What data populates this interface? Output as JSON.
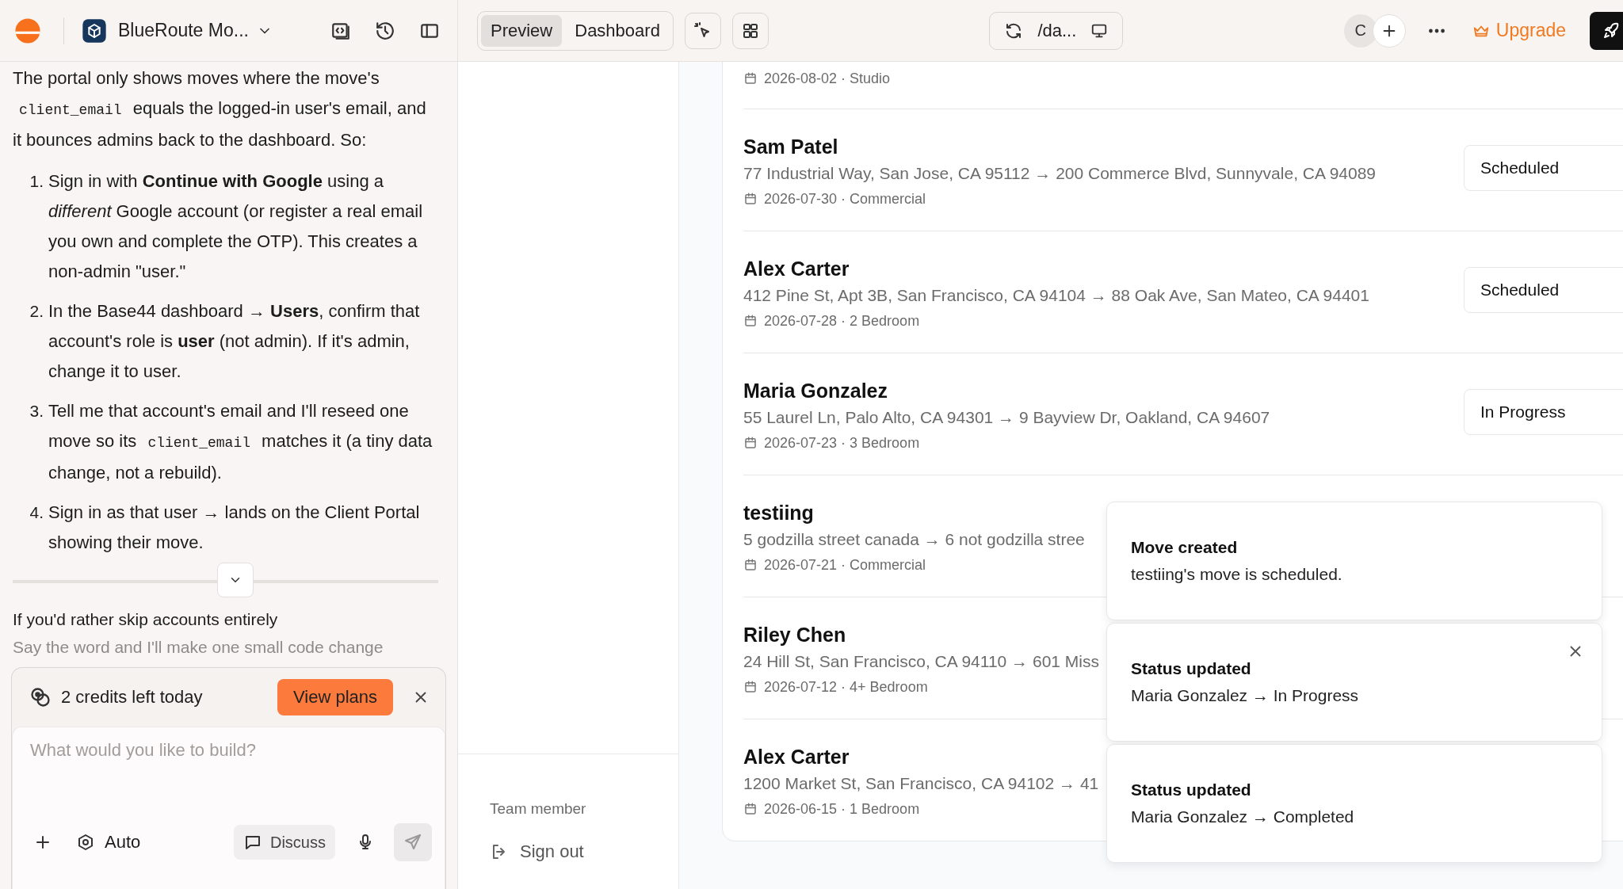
{
  "topbar": {
    "project_name": "BlueRoute Mo...",
    "view_tabs": [
      {
        "label": "Preview",
        "selected": true
      },
      {
        "label": "Dashboard",
        "selected": false
      }
    ],
    "url": "/da...",
    "avatar_initial": "C",
    "upgrade_label": "Upgrade"
  },
  "chat": {
    "paragraph": [
      {
        "kind": "text",
        "text": "The portal only shows moves where the move's "
      },
      {
        "kind": "code",
        "text": "client_email"
      },
      {
        "kind": "text",
        "text": " equals the logged-in user's email, and it bounces admins back to the dashboard. So:"
      }
    ],
    "steps": [
      {
        "number": "1.",
        "parts": [
          {
            "kind": "text",
            "text": "Sign in with **Continue with Google** using a *different* Google account (or register a real email you own and complete the OTP). This creates a non-admin \"user.\""
          }
        ]
      },
      {
        "number": "2.",
        "parts": [
          {
            "kind": "text",
            "text": "In the Base44 dashboard → **Users**, confirm that account's role is **user** (not admin). If it's admin, change it to user."
          }
        ]
      },
      {
        "number": "3.",
        "parts": [
          {
            "kind": "text",
            "text": "Tell me that account's email and I'll reseed one move so its "
          },
          {
            "kind": "code",
            "text": "client_email"
          },
          {
            "kind": "text",
            "text": " matches it (a tiny data change, not a rebuild)."
          }
        ]
      },
      {
        "number": "4.",
        "parts": [
          {
            "kind": "text",
            "text": "Sign in as that user → lands on the Client Portal showing their move."
          }
        ]
      }
    ],
    "followup": "If you'd rather skip accounts entirely",
    "faded_line": "Say the word and I'll make one small code change"
  },
  "composer": {
    "credits": "2 credits left today",
    "plans_button": "View plans",
    "placeholder": "What would you like to build?",
    "mode": "Auto",
    "discuss": "Discuss"
  },
  "sidebar": {
    "role": "Team member",
    "sign_out": "Sign out"
  },
  "moves": [
    {
      "meta": "2026-08-02 · Studio"
    },
    {
      "name": "Sam Patel",
      "address": "77 Industrial Way, San Jose, CA 95112 → 200 Commerce Blvd, Sunnyvale, CA 94089",
      "meta": "2026-07-30 · Commercial",
      "status": "Scheduled"
    },
    {
      "name": "Alex Carter",
      "address": "412 Pine St, Apt 3B, San Francisco, CA 94104 → 88 Oak Ave, San Mateo, CA 94401",
      "meta": "2026-07-28 · 2 Bedroom",
      "status": "Scheduled"
    },
    {
      "name": "Maria Gonzalez",
      "address": "55 Laurel Ln, Palo Alto, CA 94301 → 9 Bayview Dr, Oakland, CA 94607",
      "meta": "2026-07-23 · 3 Bedroom",
      "status": "In Progress"
    },
    {
      "name": "testiing",
      "address": "5 godzilla street canada → 6 not godzilla stree",
      "meta": "2026-07-21 · Commercial"
    },
    {
      "name": "Riley Chen",
      "address": "24 Hill St, San Francisco, CA 94110 → 601 Miss",
      "meta": "2026-07-12 · 4+ Bedroom"
    },
    {
      "name": "Alex Carter",
      "address": "1200 Market St, San Francisco, CA 94102 → 41",
      "meta": "2026-06-15 · 1 Bedroom"
    }
  ],
  "toasts": [
    {
      "title": "Move created",
      "body": "testiing's move is scheduled.",
      "closable": false
    },
    {
      "title": "Status updated",
      "body": "Maria Gonzalez → In Progress",
      "closable": true
    },
    {
      "title": "Status updated",
      "body": "Maria Gonzalez → Completed",
      "closable": false
    }
  ]
}
